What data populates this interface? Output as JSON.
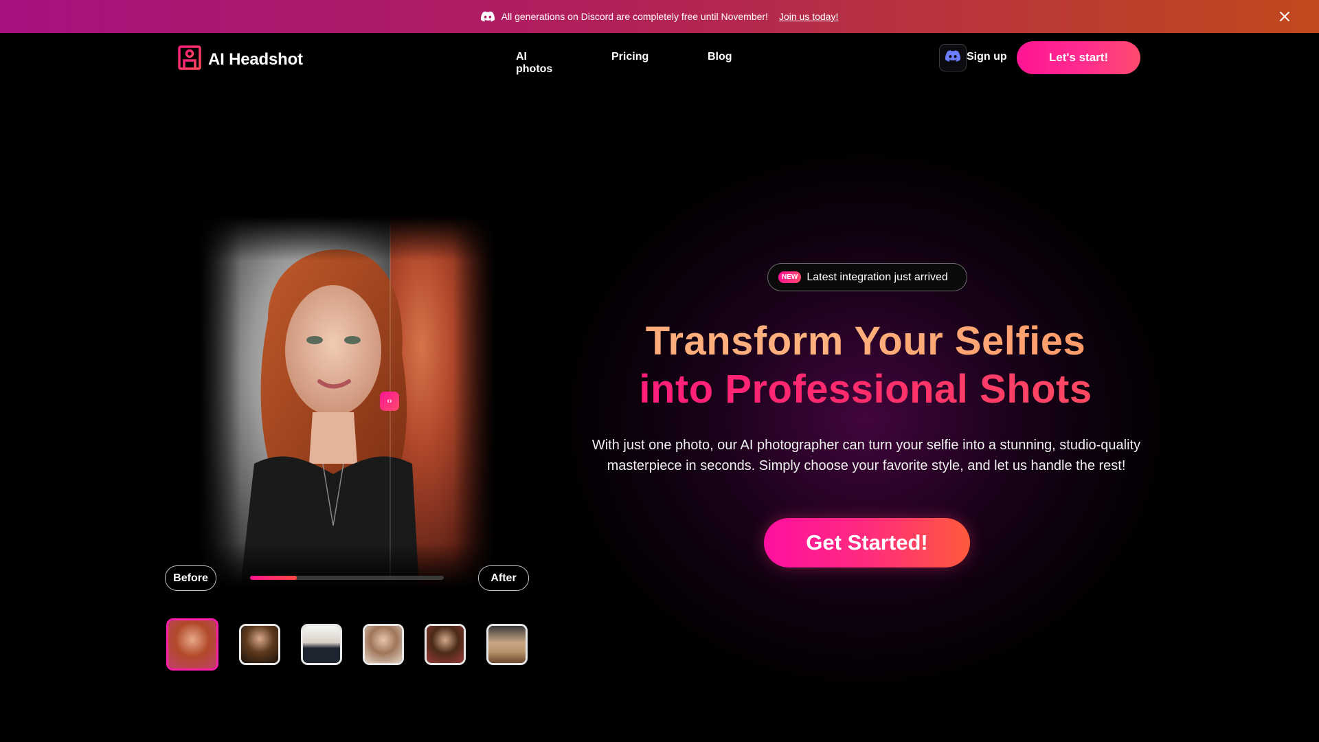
{
  "banner": {
    "message": "All generations on Discord are completely free until November!",
    "link_text": "Join us today!"
  },
  "nav": {
    "logo_text": "AI Headshot",
    "links": [
      "AI photos",
      "Pricing",
      "Blog"
    ],
    "signup_label": "Sign up",
    "start_label": "Let's start!"
  },
  "hero": {
    "badge_tag": "NEW",
    "badge_text": "Latest integration just arrived",
    "headline_line1": "Transform Your Selfies",
    "headline_line2": "into Professional Shots",
    "subtext": "With just one photo, our AI photographer can turn your selfie into a stunning, studio-quality masterpiece in seconds. Simply choose your favorite style, and let us handle the rest!",
    "cta_label": "Get Started!"
  },
  "comparison": {
    "before_label": "Before",
    "after_label": "After",
    "progress_percent": 24,
    "thumbnail_count": 6,
    "active_thumbnail_index": 0
  },
  "colors": {
    "accent_pink": "#ff1493",
    "accent_orange": "#ff4b3e",
    "background": "#000000"
  },
  "icons": [
    "discord-icon",
    "close-icon",
    "logo-icon",
    "new-badge"
  ]
}
